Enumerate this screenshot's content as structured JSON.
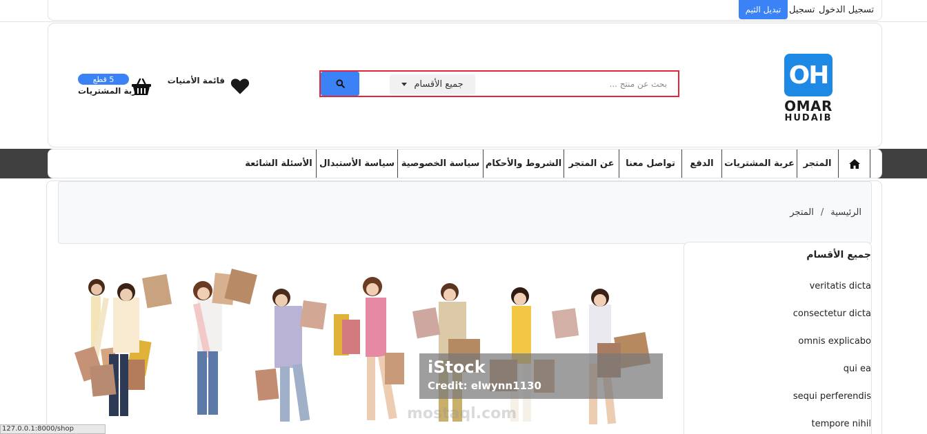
{
  "topbar": {
    "login_label": "تسجيل الدخول",
    "register_label": "تسجيل",
    "theme_button_label": "تبديل الثيم"
  },
  "brand": {
    "logo_initials": "OH",
    "logo_line1": "OMAR",
    "logo_line2": "HUDAIB",
    "accent_color": "#1e88e5"
  },
  "search": {
    "placeholder": "بحث عن منتج ...",
    "category_selected": "جميع الأقسام",
    "button_icon": "search-icon"
  },
  "wishlist": {
    "label": "قائمة الأمنيات",
    "icon": "heart-icon"
  },
  "cart": {
    "badge": "5 قطع",
    "label": "عربة المشتريات",
    "icon": "basket-icon"
  },
  "nav": {
    "home_icon": "home-icon",
    "items": [
      {
        "label": "المتجر"
      },
      {
        "label": "عربة المشتريات"
      },
      {
        "label": "الدفع"
      },
      {
        "label": "تواصل معنا"
      },
      {
        "label": "عن المتجر"
      },
      {
        "label": "الشروط والأحكام"
      },
      {
        "label": "سياسة الخصوصية"
      },
      {
        "label": "سياسة الأستبدال"
      },
      {
        "label": "الأسئلة الشائعة"
      }
    ]
  },
  "breadcrumb": {
    "home": "الرئيسية",
    "separator": "/",
    "current": "المتجر"
  },
  "sidebar": {
    "title": "جميع الأقسام",
    "categories": [
      {
        "label": "veritatis dicta"
      },
      {
        "label": "consectetur dicta"
      },
      {
        "label": "omnis explicabo"
      },
      {
        "label": "qui ea"
      },
      {
        "label": "sequi perferendis"
      },
      {
        "label": "tempore nihil"
      }
    ]
  },
  "banner": {
    "watermark_brand": "iStock",
    "watermark_credit": "Credit: elwynn1130",
    "watermark_site": "mostaql.com"
  },
  "statusbar": {
    "url": "127.0.0.1:8000/shop"
  },
  "colors": {
    "primary": "#3b82f6",
    "search_border": "#e32636",
    "nav_background": "#404040"
  }
}
